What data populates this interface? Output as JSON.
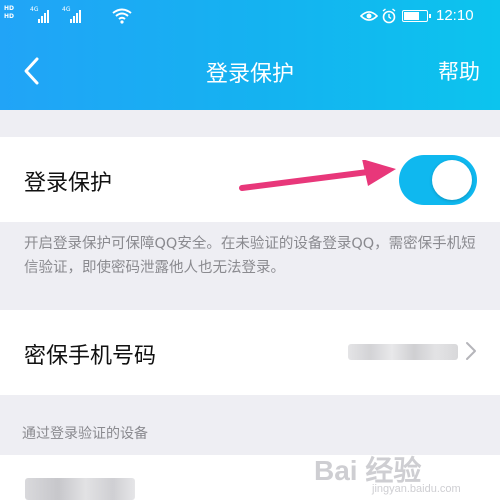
{
  "status_bar": {
    "hd_labels": [
      "HD",
      "HD"
    ],
    "signal_labels": [
      "4G",
      "4G"
    ],
    "time": "12:10",
    "icons": [
      "hd-icon",
      "signal-icon",
      "wifi-icon",
      "eye-icon",
      "alarm-icon",
      "battery-icon"
    ]
  },
  "header": {
    "title": "登录保护",
    "help_label": "帮助",
    "back_icon": "back-arrow-icon"
  },
  "login_protection": {
    "label": "登录保护",
    "toggle_on": true,
    "accent_color": "#0fb8ef",
    "description": "开启登录保护可保障QQ安全。在未验证的设备登录QQ，需密保手机短信验证，即使密码泄露他人也无法登录。"
  },
  "security_phone": {
    "label": "密保手机号码",
    "chevron_icon": "chevron-right-icon"
  },
  "verified_devices": {
    "section_title": "通过登录验证的设备"
  },
  "watermark": {
    "logo": "Bai 经验",
    "url": "jingyan.baidu.com"
  },
  "annotation": {
    "arrow_color": "#e8377a"
  }
}
